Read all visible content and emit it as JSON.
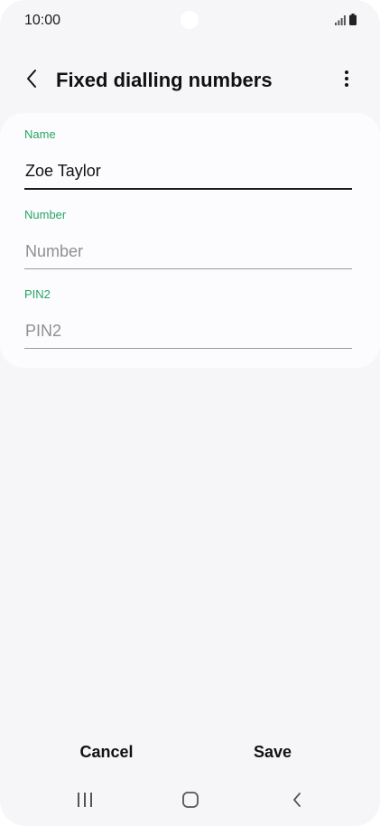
{
  "status_bar": {
    "time": "10:00",
    "icons": [
      "signal-icon",
      "battery-icon"
    ]
  },
  "app_bar": {
    "title": "Fixed dialling numbers",
    "back_icon": "chevron-left-icon",
    "more_icon": "more-vertical-icon"
  },
  "form": {
    "name": {
      "label": "Name",
      "value": "Zoe Taylor",
      "placeholder": "Name"
    },
    "number": {
      "label": "Number",
      "value": "",
      "placeholder": "Number"
    },
    "pin2": {
      "label": "PIN2",
      "value": "",
      "placeholder": "PIN2"
    }
  },
  "actions": {
    "cancel_label": "Cancel",
    "save_label": "Save"
  },
  "nav_bar": {
    "icons": [
      "recent-apps-icon",
      "home-icon",
      "back-icon"
    ]
  },
  "colors": {
    "accent": "#27a561",
    "background": "#f6f6f8",
    "card": "#fcfcff",
    "text": "#111111",
    "placeholder": "#8f8f8f"
  }
}
